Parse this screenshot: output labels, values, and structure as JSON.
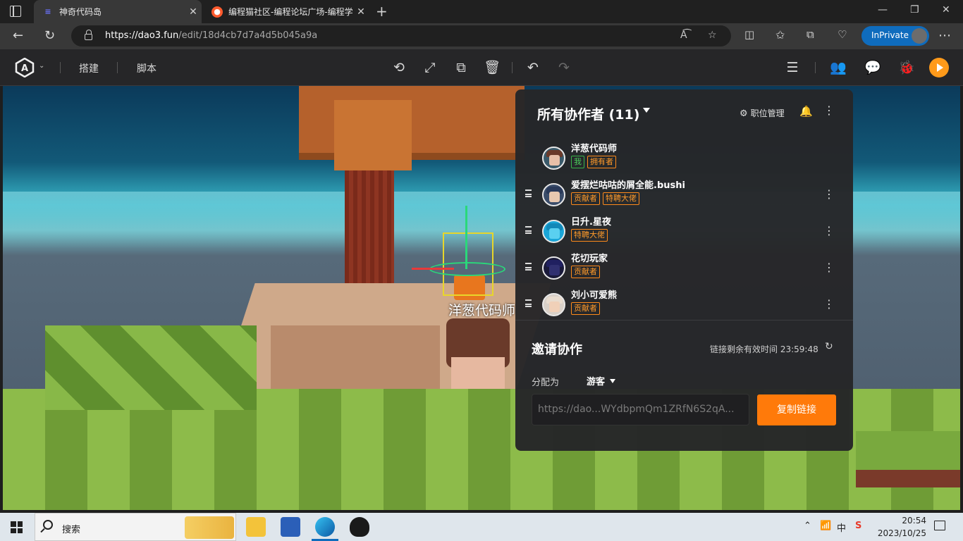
{
  "browser": {
    "tabs": [
      {
        "title": "神奇代码岛",
        "active": true
      },
      {
        "title": "编程猫社区-编程论坛广场-编程学",
        "active": false
      }
    ],
    "url_host": "https://dao3.fun",
    "url_path": "/edit/18d4cb7d7a4d5b045a9a",
    "inprivate_label": "InPrivate"
  },
  "editor": {
    "menus": {
      "build": "搭建",
      "script": "脚本"
    },
    "accent": "#ff9a1a"
  },
  "scene": {
    "player_name": "洋葱代码师"
  },
  "panel": {
    "title": "所有协作者 (11)",
    "role_mgmt": "职位管理",
    "members": [
      {
        "name": "洋葱代码师",
        "badges": [
          {
            "text": "我",
            "color": "green"
          },
          {
            "text": "拥有者",
            "color": "orange"
          }
        ],
        "draggable": false
      },
      {
        "name": "爱摆烂咕咕的屑全能.bushi",
        "badges": [
          {
            "text": "贡献者",
            "color": "orange"
          },
          {
            "text": "特聘大佬",
            "color": "orange"
          }
        ],
        "draggable": true
      },
      {
        "name": "日升.星夜",
        "badges": [
          {
            "text": "特聘大佬",
            "color": "orange"
          }
        ],
        "draggable": true
      },
      {
        "name": "花切玩家",
        "badges": [
          {
            "text": "贡献者",
            "color": "orange"
          }
        ],
        "draggable": true
      },
      {
        "name": "刘小可爱熊",
        "badges": [
          {
            "text": "贡献者",
            "color": "orange"
          }
        ],
        "draggable": true
      }
    ],
    "invite": {
      "title": "邀请协作",
      "expiry": "链接剩余有效时间 23:59:48",
      "assign_label": "分配为",
      "assign_value": "游客",
      "link_value": "https://dao...WYdbpmQm1ZRfN6S2qA...",
      "copy_label": "复制链接"
    }
  },
  "taskbar": {
    "search_placeholder": "搜索",
    "ime": "中",
    "time": "20:54",
    "date": "2023/10/25"
  }
}
